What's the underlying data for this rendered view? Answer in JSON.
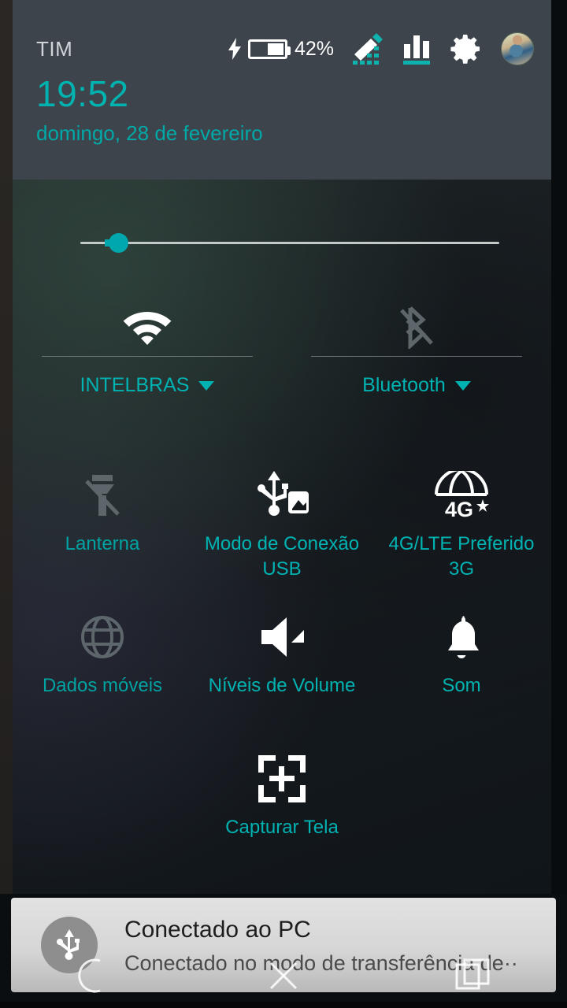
{
  "header": {
    "carrier": "TIM",
    "battery_percent": "42%",
    "clock": "19:52",
    "date": "domingo, 28 de fevereiro",
    "icons": {
      "charging": "charging-bolt-icon",
      "battery": "battery-icon",
      "edit": "edit-pencil-icon",
      "stats": "signal-bars-icon",
      "settings": "gear-icon",
      "avatar": "user-avatar"
    }
  },
  "brightness": {
    "name": "brightness-slider",
    "value_percent": 9
  },
  "wide_tiles": [
    {
      "label": "INTELBRAS",
      "icon": "wifi-icon",
      "state": "on"
    },
    {
      "label": "Bluetooth",
      "icon": "bluetooth-off-icon",
      "state": "off"
    }
  ],
  "tiles": [
    {
      "label": "Lanterna",
      "icon": "flashlight-off-icon",
      "state": "off"
    },
    {
      "label": "Modo de Conexão USB",
      "icon": "usb-transfer-icon",
      "state": "on"
    },
    {
      "label": "4G/LTE Preferido 3G",
      "icon": "network-4g-icon",
      "state": "on"
    },
    {
      "label": "Dados móveis",
      "icon": "mobile-data-off-icon",
      "state": "off"
    },
    {
      "label": "Níveis de Volume",
      "icon": "volume-icon",
      "state": "on"
    },
    {
      "label": "Som",
      "icon": "bell-icon",
      "state": "on"
    },
    {
      "label": "Capturar Tela",
      "icon": "screenshot-capture-icon",
      "state": "on"
    }
  ],
  "notification": {
    "title": "Conectado ao PC",
    "body": "Conectado no modo de transferência de··",
    "icon": "usb-icon"
  },
  "navbar": {
    "back": "back-icon",
    "home": "close-x-icon",
    "recents": "recents-icon"
  },
  "colors": {
    "accent_teal": "#00b3b2",
    "header_bg": "#3d444b",
    "inactive_gray": "#5a6268"
  }
}
